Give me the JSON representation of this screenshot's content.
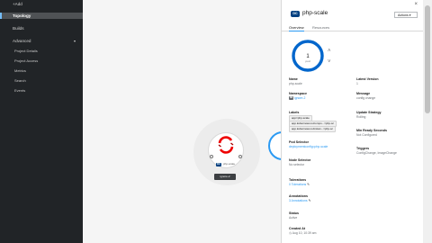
{
  "sidebar": {
    "add": "+Add",
    "topology": "Topology",
    "builds": "Builds",
    "advanced": "Advanced",
    "chevron": "▾",
    "subitems": [
      "Project Details",
      "Project Access",
      "Metrics",
      "Search",
      "Events"
    ]
  },
  "topology_node": {
    "badge": "DC",
    "name": "php-scale",
    "app_label": "ignore-2"
  },
  "panel": {
    "badge": "DC",
    "title": "php-scale",
    "close": "×",
    "actions_label": "Actions ▾",
    "tabs": [
      {
        "label": "Overview",
        "active": true
      },
      {
        "label": "Resources",
        "active": false
      }
    ],
    "pod_count": "1",
    "pod_unit": "pod",
    "scale_up": "˄",
    "scale_down": "˅"
  },
  "details_left": {
    "name_label": "Name",
    "name_value": "php-scale",
    "namespace_label": "Namespace",
    "namespace_badge": "NS",
    "namespace_value": "ignore-2",
    "labels_label": "Labels",
    "labels": [
      "app=php-scale",
      "app.kubernetes.io/compo...=php-sc",
      "app.kubernetes.io/instan...=php-sc"
    ],
    "pod_selector_label": "Pod Selector",
    "pod_selector_value": "deploymentconfig=php-scale",
    "node_selector_label": "Node Selector",
    "node_selector_value": "No selector",
    "tolerations_label": "Tolerations",
    "tolerations_value": "0 Tolerations",
    "annotations_label": "Annotations",
    "annotations_value": "3 Annotations",
    "status_label": "Status",
    "status_value": "Active",
    "created_label": "Created At",
    "created_value": "Aug 10, 10:39 am"
  },
  "details_right": {
    "latest_version_label": "Latest Version",
    "latest_version_value": "1",
    "message_label": "Message",
    "message_value": "config change",
    "update_strategy_label": "Update Strategy",
    "update_strategy_value": "Rolling",
    "min_ready_label": "Min Ready Seconds",
    "min_ready_value": "Not Configured",
    "triggers_label": "Triggers",
    "triggers_value": "ConfigChange, ImageChange"
  },
  "colors": {
    "sidebar_bg": "#212427",
    "accent": "#2b9af3",
    "dc_badge": "#004080",
    "openshift_red": "#e00"
  },
  "icons": {
    "pencil": "✎",
    "clock": "◷"
  }
}
